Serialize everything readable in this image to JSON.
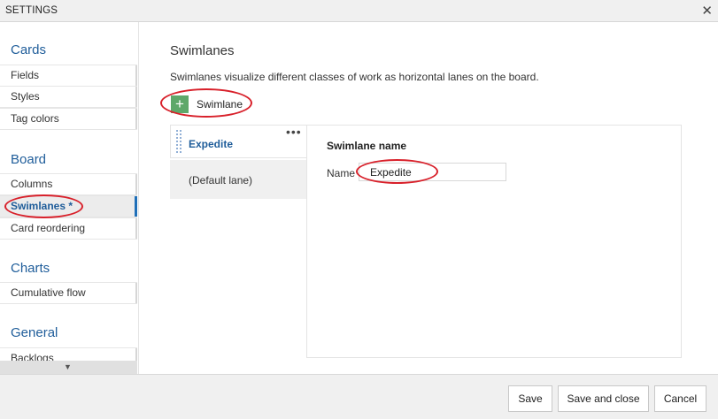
{
  "window": {
    "title": "SETTINGS",
    "close_glyph": "✕"
  },
  "sidebar": {
    "sections": [
      {
        "title": "Cards",
        "items": [
          "Fields",
          "Styles",
          "Tag colors"
        ]
      },
      {
        "title": "Board",
        "items": [
          "Columns",
          "Swimlanes *",
          "Card reordering"
        ]
      },
      {
        "title": "Charts",
        "items": [
          "Cumulative flow"
        ]
      },
      {
        "title": "General",
        "items": [
          "Backlogs"
        ]
      }
    ],
    "selected_item": "Swimlanes *"
  },
  "main": {
    "title": "Swimlanes",
    "description": "Swimlanes visualize different classes of work as horizontal lanes on the board.",
    "add_button_label": "Swimlane",
    "lanes": [
      "Expedite",
      "(Default lane)"
    ],
    "more_glyph": "•••",
    "details": {
      "heading": "Swimlane name",
      "name_label": "Name",
      "name_value": "Expedite"
    }
  },
  "footer": {
    "save": "Save",
    "save_close": "Save and close",
    "cancel": "Cancel"
  },
  "icons": {
    "add": "plus-icon",
    "close": "close-icon",
    "grip": "drag-grip-icon",
    "more": "more-actions-icon",
    "scroll": "scroll-down-arrow-icon"
  },
  "colors": {
    "accent": "#1f5d9a",
    "add_button": "#5ea86a",
    "annotation": "#d8202a",
    "selection_bar": "#1f6fb8"
  }
}
